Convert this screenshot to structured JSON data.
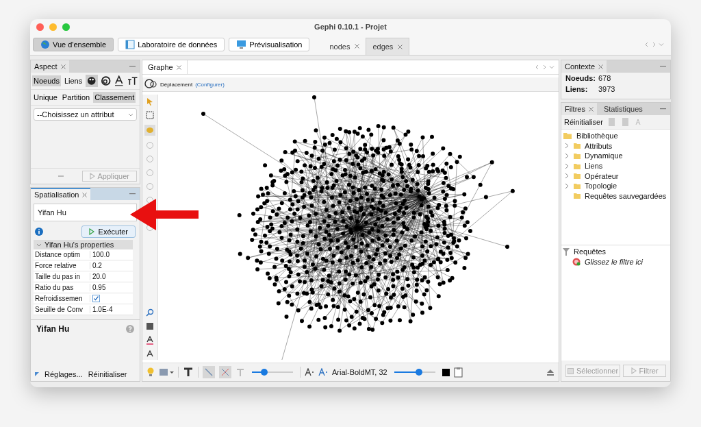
{
  "window": {
    "title": "Gephi 0.10.1 - Projet"
  },
  "workspaces": [
    {
      "label": "Vue d'ensemble",
      "selected": true
    },
    {
      "label": "Laboratoire de données",
      "selected": false
    },
    {
      "label": "Prévisualisation",
      "selected": false
    }
  ],
  "documents": [
    {
      "label": "nodes",
      "selected": false
    },
    {
      "label": "edges",
      "selected": true
    }
  ],
  "aspect": {
    "title": "Aspect",
    "targets": [
      {
        "label": "Noeuds",
        "selected": true
      },
      {
        "label": "Liens",
        "selected": false
      }
    ],
    "modes": [
      {
        "label": "Unique",
        "selected": false
      },
      {
        "label": "Partition",
        "selected": false
      },
      {
        "label": "Classement",
        "selected": true
      }
    ],
    "attribute": {
      "value": "--Choisissez un attribut"
    },
    "apply": {
      "label": "Appliquer",
      "disabled": true
    }
  },
  "layout": {
    "title": "Spatialisation",
    "algorithm": "Yifan Hu",
    "run": "Exécuter",
    "group": {
      "title": "Yifan Hu's properties",
      "rows": [
        {
          "label": "Distance optim",
          "kind": "text",
          "value": "100.0"
        },
        {
          "label": "Force relative",
          "kind": "text",
          "value": "0.2"
        },
        {
          "label": "Taille du pas in",
          "kind": "text",
          "value": "20.0"
        },
        {
          "label": "Ratio du pas",
          "kind": "text",
          "value": "0.95"
        },
        {
          "label": "Refroidissemen",
          "kind": "checkbox",
          "checked": true
        },
        {
          "label": "Seuille de Conv",
          "kind": "text",
          "value": "1.0E-4"
        }
      ]
    },
    "description": "Yifan Hu",
    "presets": "Réglages...",
    "reset": "Réinitialiser"
  },
  "graph": {
    "tab": "Graphe",
    "tool": "Déplacement",
    "configure": "(Configurer)",
    "font": "Arial-BoldMT, 32",
    "size_slider": {
      "level": 0.3
    },
    "font_slider": {
      "level": 0.6
    }
  },
  "context": {
    "title": "Contexte",
    "stats": [
      {
        "label": "Noeuds:",
        "value": "678"
      },
      {
        "label": "Liens:",
        "value": "3973"
      }
    ]
  },
  "filters": {
    "tabs": [
      {
        "label": "Filtres",
        "selected": true
      },
      {
        "label": "Statistiques",
        "selected": false
      }
    ],
    "reset": "Réinitialiser",
    "library": {
      "label": "Bibliothèque",
      "children": [
        {
          "label": "Attributs",
          "expandable": true
        },
        {
          "label": "Dynamique",
          "expandable": true
        },
        {
          "label": "Liens",
          "expandable": true
        },
        {
          "label": "Opérateur",
          "expandable": true
        },
        {
          "label": "Topologie",
          "expandable": true
        },
        {
          "label": "Requêtes sauvegardées",
          "expandable": false
        }
      ]
    },
    "queries": {
      "label": "Requêtes",
      "hint": "Glissez le filtre ici"
    },
    "select": "Sélectionner",
    "filter": "Filtrer"
  }
}
